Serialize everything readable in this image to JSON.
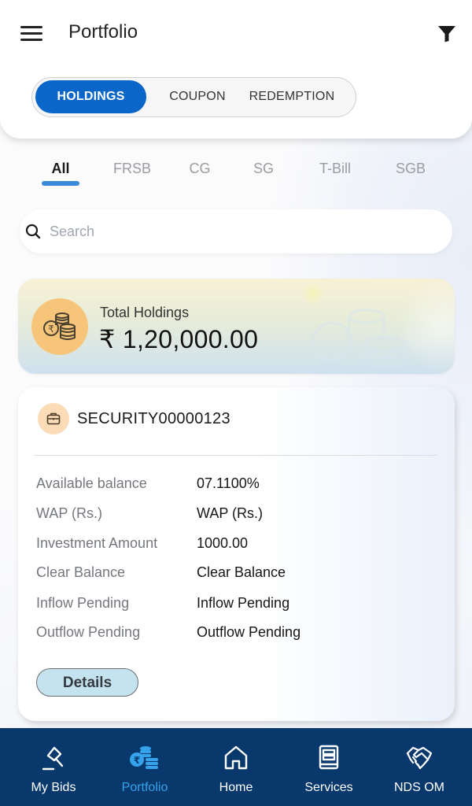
{
  "header": {
    "title": "Portfolio",
    "menu_icon": "hamburger-menu-icon",
    "filter_icon": "filter-funnel-icon"
  },
  "segments": [
    {
      "label": "HOLDINGS",
      "active": true
    },
    {
      "label": "COUPON",
      "active": false
    },
    {
      "label": "REDEMPTION",
      "active": false
    }
  ],
  "categories": [
    {
      "label": "All",
      "active": true
    },
    {
      "label": "FRSB",
      "active": false
    },
    {
      "label": "CG",
      "active": false
    },
    {
      "label": "SG",
      "active": false
    },
    {
      "label": "T-Bill",
      "active": false
    },
    {
      "label": "SGB",
      "active": false
    }
  ],
  "search": {
    "placeholder": "Search",
    "value": "",
    "icon": "search-icon"
  },
  "total_holdings": {
    "label": "Total Holdings",
    "value": "₹ 1,20,000.00",
    "icon": "rupee-coins-icon"
  },
  "security": {
    "name": "SECURITY00000123",
    "icon": "briefcase-icon",
    "rows": [
      {
        "label": "Available balance",
        "value": "07.1100%"
      },
      {
        "label": "WAP (Rs.)",
        "value": "WAP (Rs.)"
      },
      {
        "label": "Investment Amount",
        "value": "1000.00"
      },
      {
        "label": "Clear Balance",
        "value": "Clear Balance"
      },
      {
        "label": "Inflow Pending",
        "value": "Inflow Pending"
      },
      {
        "label": "Outflow Pending",
        "value": "Outflow Pending"
      }
    ],
    "details_label": "Details"
  },
  "bottom_nav": [
    {
      "label": "My Bids",
      "icon": "gavel-icon",
      "active": false
    },
    {
      "label": "Portfolio",
      "icon": "rupee-coins-icon",
      "active": true
    },
    {
      "label": "Home",
      "icon": "home-icon",
      "active": false
    },
    {
      "label": "Services",
      "icon": "services-book-icon",
      "active": false
    },
    {
      "label": "NDS OM",
      "icon": "handshake-icon",
      "active": false
    }
  ],
  "colors": {
    "primary": "#0a67c9",
    "tab_underline": "#3a8ad8",
    "nav_background": "#08386c",
    "nav_active": "#35a3eb",
    "coin_badge": "#f6c57a",
    "details_button": "#c5e2ef"
  }
}
